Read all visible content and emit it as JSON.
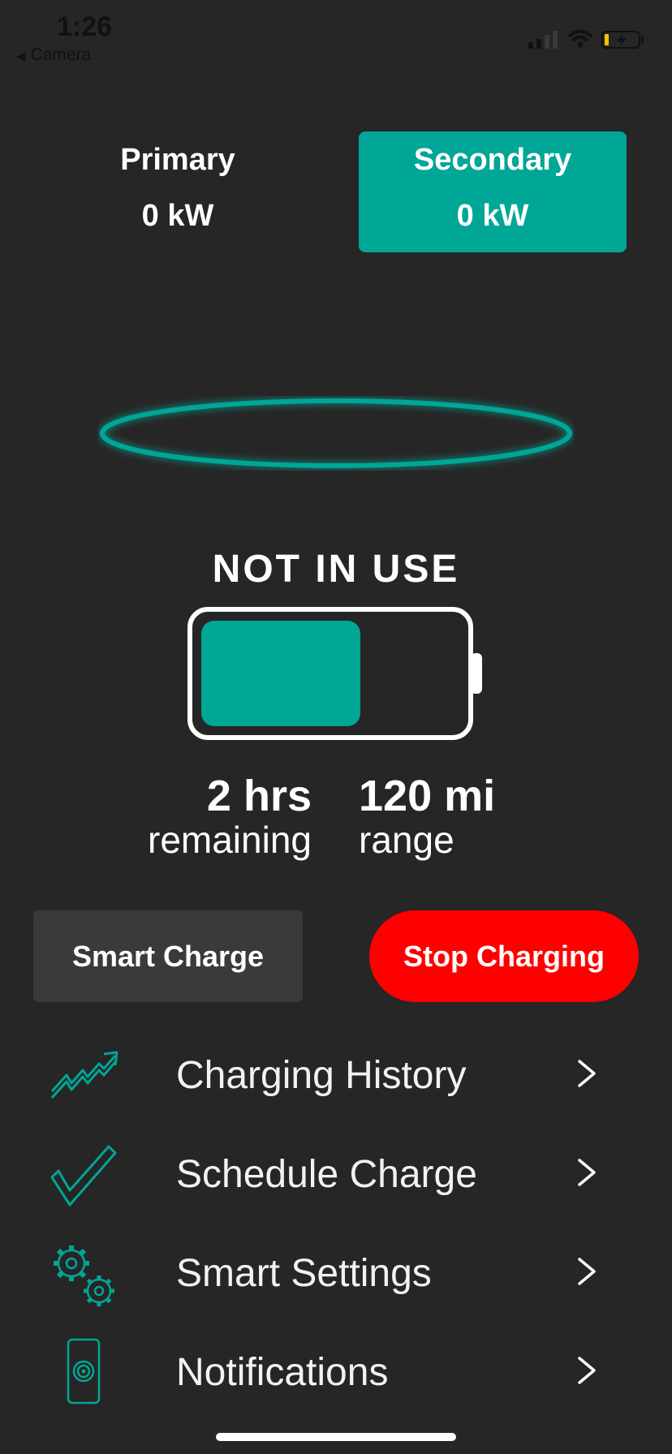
{
  "status_bar": {
    "time": "1:26",
    "back_label": "Camera"
  },
  "sources": {
    "primary": {
      "name": "Primary",
      "value": "0 kW"
    },
    "secondary": {
      "name": "Secondary",
      "value": "0 kW"
    },
    "selected": "secondary"
  },
  "charger": {
    "status": "NOT IN USE",
    "battery_level": 0.6,
    "time_value": "2 hrs",
    "time_label": "remaining",
    "range_value": "120 mi",
    "range_label": "range"
  },
  "actions": {
    "smart_charge": "Smart Charge",
    "stop_charging": "Stop Charging"
  },
  "menu": [
    {
      "label": "Charging History",
      "icon": "trend-up-icon"
    },
    {
      "label": "Schedule Charge",
      "icon": "checkmark-icon"
    },
    {
      "label": "Smart Settings",
      "icon": "gears-icon"
    },
    {
      "label": "Notifications",
      "icon": "phone-signal-icon"
    }
  ],
  "colors": {
    "background": "#262626",
    "accent": "#00a696",
    "stop": "#ff0000",
    "button_dark": "#3a3a3a"
  }
}
